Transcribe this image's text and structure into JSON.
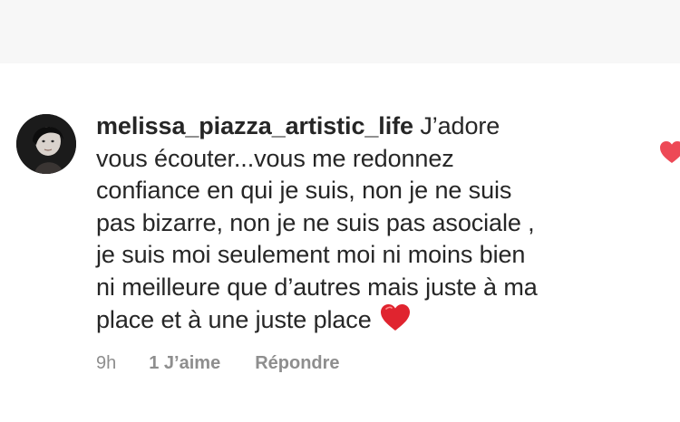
{
  "comment": {
    "username": "melissa_piazza_artistic_life",
    "lines": [
      "J’adore",
      "vous écouter...vous me redonnez",
      "confiance en qui je suis, non je ne suis",
      "pas bizarre, non je ne suis pas asociale ,",
      "je suis moi seulement moi ni moins bien",
      "ni meilleure que d’autres mais juste à ma",
      "place et à une juste place"
    ],
    "emoji": "red-heart-emoji",
    "avatar": "profile-photo-avatar",
    "like_icon": "heart-icon",
    "like_icon_color": "#ed4956"
  },
  "meta": {
    "time": "9h",
    "likes": "1 J’aime",
    "reply": "Répondre"
  }
}
